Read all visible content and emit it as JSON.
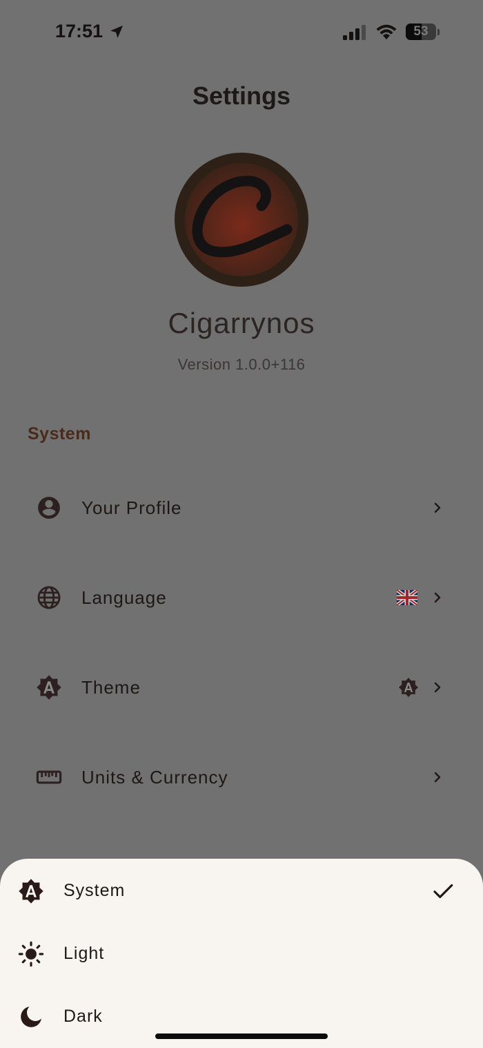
{
  "status_bar": {
    "time": "17:51",
    "battery_level": "53",
    "battery_percent": 53,
    "icons": [
      "location-arrow-icon",
      "signal-bars-icon",
      "wifi-icon",
      "battery-icon"
    ]
  },
  "page": {
    "title": "Settings"
  },
  "app": {
    "name": "Cigarrynos",
    "version": "Version 1.0.0+116"
  },
  "section": {
    "title": "System"
  },
  "rows": [
    {
      "label": "Your Profile",
      "icon": "account-circle-icon"
    },
    {
      "label": "Language",
      "icon": "globe-icon",
      "trailing": "uk-flag-icon"
    },
    {
      "label": "Theme",
      "icon": "auto-theme-icon",
      "trailing": "auto-theme-icon"
    },
    {
      "label": "Units & Currency",
      "icon": "ruler-icon"
    }
  ],
  "theme_sheet": {
    "options": [
      {
        "label": "System",
        "icon": "auto-theme-icon",
        "selected": true
      },
      {
        "label": "Light",
        "icon": "sun-icon",
        "selected": false
      },
      {
        "label": "Dark",
        "icon": "moon-icon",
        "selected": false
      }
    ]
  },
  "colors": {
    "scrim": "#717171",
    "sheet_background": "#f8f5f1",
    "accent_section": "#4a2a1a",
    "text_primary": "#1e1716",
    "logo_red": "#7a2a1a"
  }
}
